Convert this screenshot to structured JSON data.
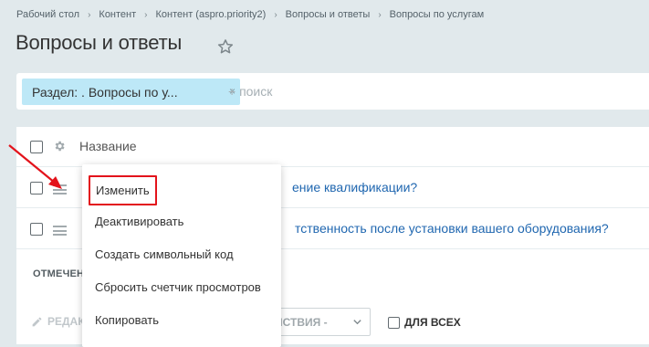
{
  "breadcrumb": [
    "Рабочий стол",
    "Контент",
    "Контент (aspro.priority2)",
    "Вопросы и ответы",
    "Вопросы по услугам"
  ],
  "breadcrumb_separator": "›",
  "page": {
    "title": "Вопросы и ответы"
  },
  "filter": {
    "tag_label": "Раздел: . Вопросы по у...",
    "tag_close": "×",
    "search_placeholder": "+ поиск"
  },
  "grid": {
    "column_name": "Название",
    "rows": [
      {
        "text": "ение квалификации?"
      },
      {
        "text": "тственность после установки вашего оборудования?"
      }
    ],
    "footer_label": "ОТМЕЧЕН"
  },
  "actions": {
    "edit_label": "РЕДАК",
    "select_label": "ЕЙСТВИЯ -",
    "for_all_label": "ДЛЯ ВСЕХ"
  },
  "context_menu": {
    "items": [
      "Изменить",
      "Деактивировать",
      "Создать символьный код",
      "Сбросить счетчик просмотров",
      "Копировать"
    ]
  },
  "colors": {
    "background": "#e1e9ec",
    "link": "#2067b0",
    "filter_tag": "#bde8f7",
    "highlight": "#e3131b"
  }
}
